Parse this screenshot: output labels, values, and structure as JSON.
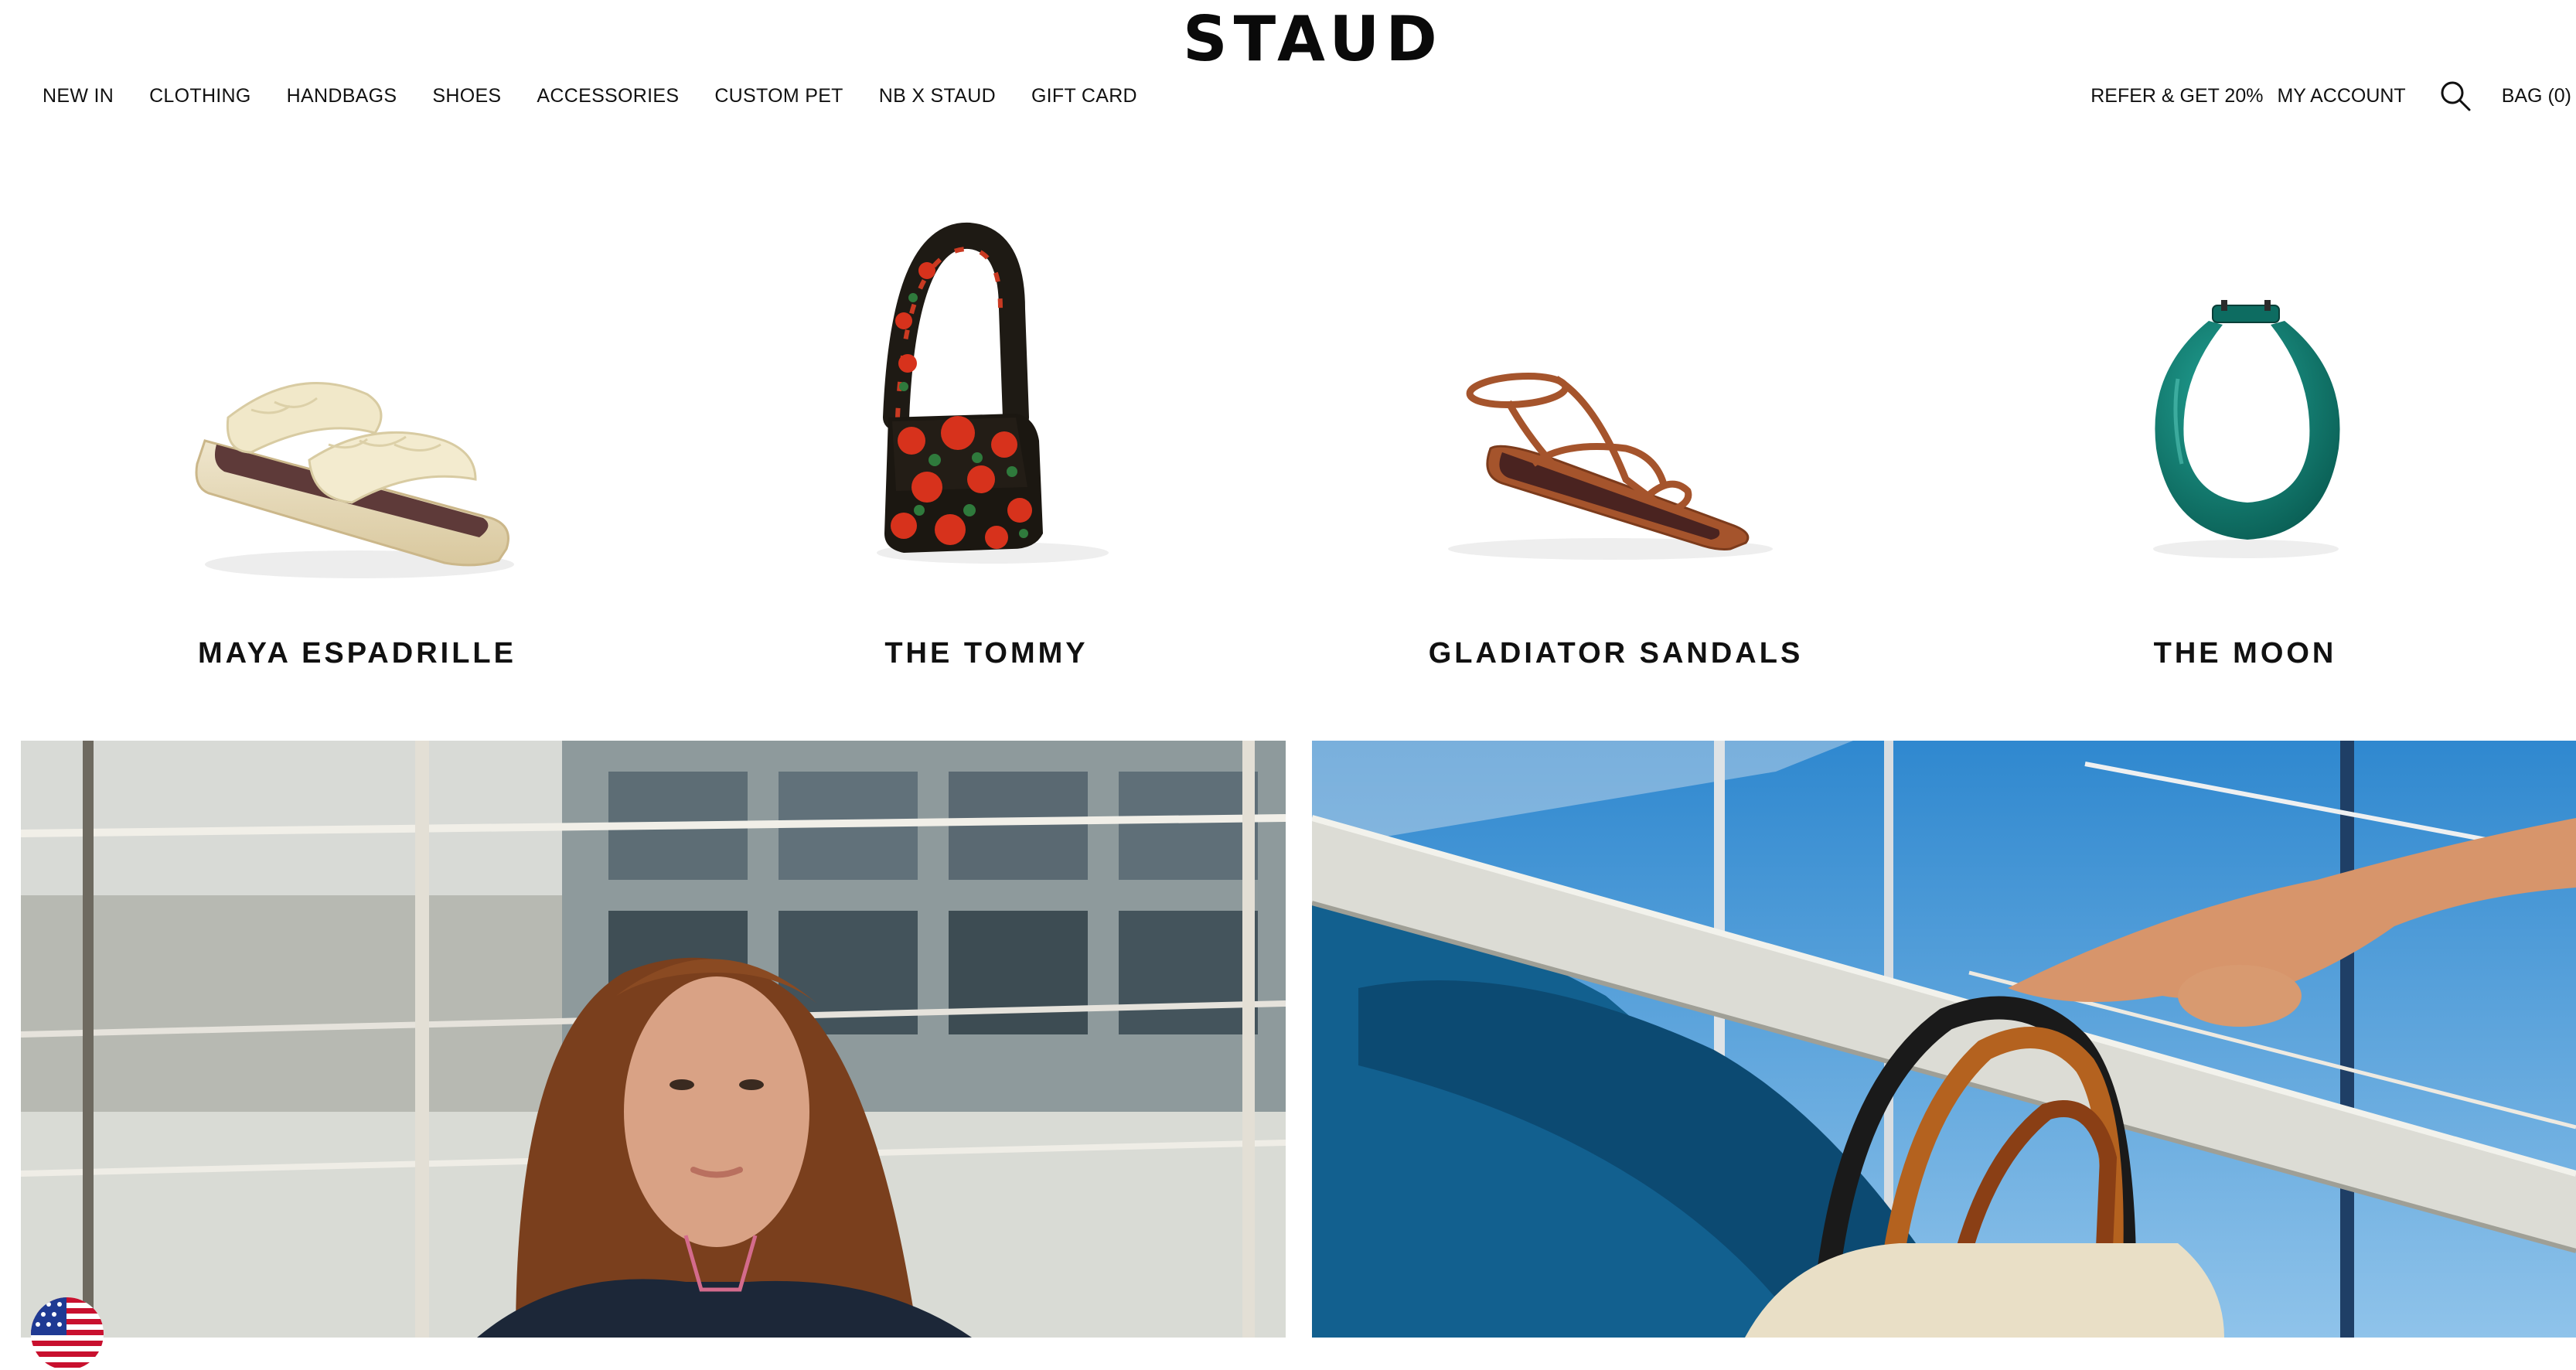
{
  "brand": {
    "logo": "STAUD"
  },
  "nav": {
    "left": [
      "NEW IN",
      "CLOTHING",
      "HANDBAGS",
      "SHOES",
      "ACCESSORIES",
      "CUSTOM PET",
      "NB X STAUD",
      "GIFT CARD"
    ],
    "refer": "REFER & GET 20%",
    "account": "MY ACCOUNT",
    "search_icon": "search-icon",
    "bag": "BAG (0)"
  },
  "products": [
    {
      "name": "MAYA ESPADRILLE",
      "image": "cream-espadrille-slide"
    },
    {
      "name": "THE TOMMY",
      "image": "red-floral-beaded-shoulder-bag"
    },
    {
      "name": "GLADIATOR SANDALS",
      "image": "tan-strappy-sandal"
    },
    {
      "name": "THE MOON",
      "image": "teal-moon-bag"
    }
  ],
  "heroes": [
    {
      "image": "model-on-boat-portrait"
    },
    {
      "image": "hand-holding-bag-on-sailboat"
    }
  ],
  "colors": {
    "text": "#111111",
    "background": "#ffffff",
    "moon_teal": "#0e7f72",
    "tommy_red": "#d7321c",
    "sandal_tan": "#a5542c",
    "espadrille_cream": "#ece3c3",
    "sky_blue": "#3b8fd0"
  },
  "locale_flag": "us-flag-icon"
}
